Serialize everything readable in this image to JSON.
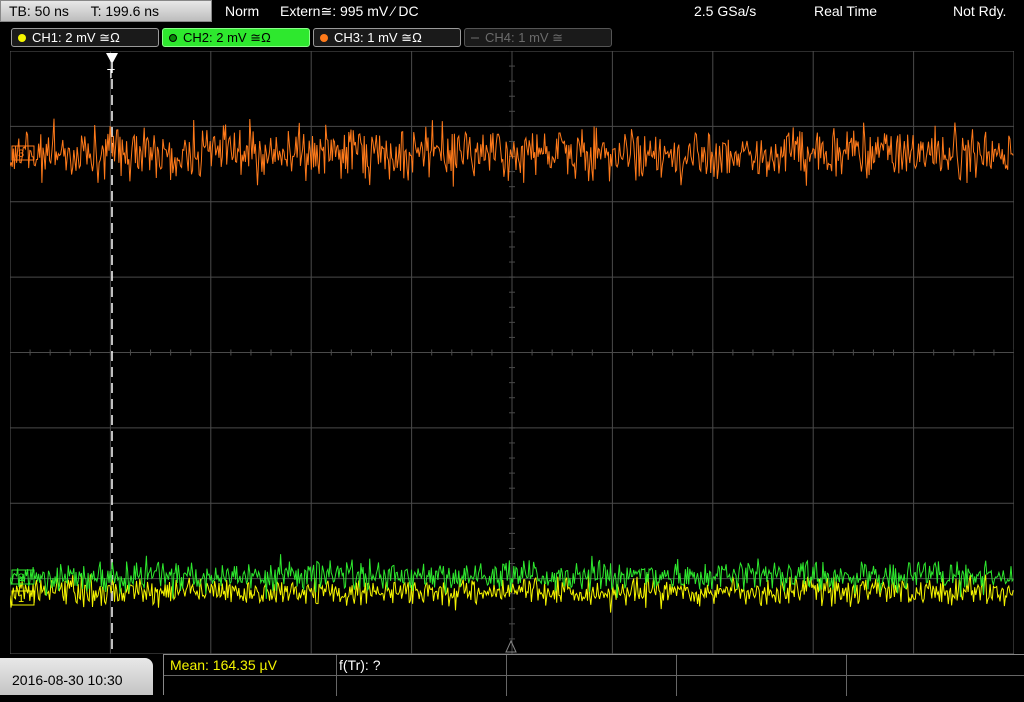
{
  "header": {
    "timebase": "TB: 50 ns",
    "trigger_time": "T: 199.6 ns",
    "mode": "Norm",
    "trigger_source": "Extern≅: 995 mV ⁄ DC",
    "sample_rate": "2.5 GSa/s",
    "acq_mode": "Real Time",
    "status": "Not Rdy."
  },
  "channels": [
    {
      "label": "CH1: 2 mV ≅Ω",
      "color": "#f5f500",
      "state": "on"
    },
    {
      "label": "CH2: 2 mV ≅Ω",
      "color": "#2ee82e",
      "state": "active"
    },
    {
      "label": "CH3: 1 mV ≅Ω",
      "color": "#ff7a1a",
      "state": "on"
    },
    {
      "label": "CH4: 1 mV ≅",
      "color": "#6b6b6b",
      "state": "off"
    }
  ],
  "markers": {
    "trigger": "T",
    "ch3_ref": "3",
    "ch1_ref": "1",
    "ch2_ref": "2"
  },
  "footer": {
    "datetime": "2016-08-30 10:30",
    "mean": "Mean: 164.35 µV",
    "freq": "f(Tr): ?"
  },
  "colors": {
    "ch1": "#f5f500",
    "ch2": "#2ee82e",
    "ch3": "#ff7a1a",
    "grid": "#4a4a4a"
  }
}
